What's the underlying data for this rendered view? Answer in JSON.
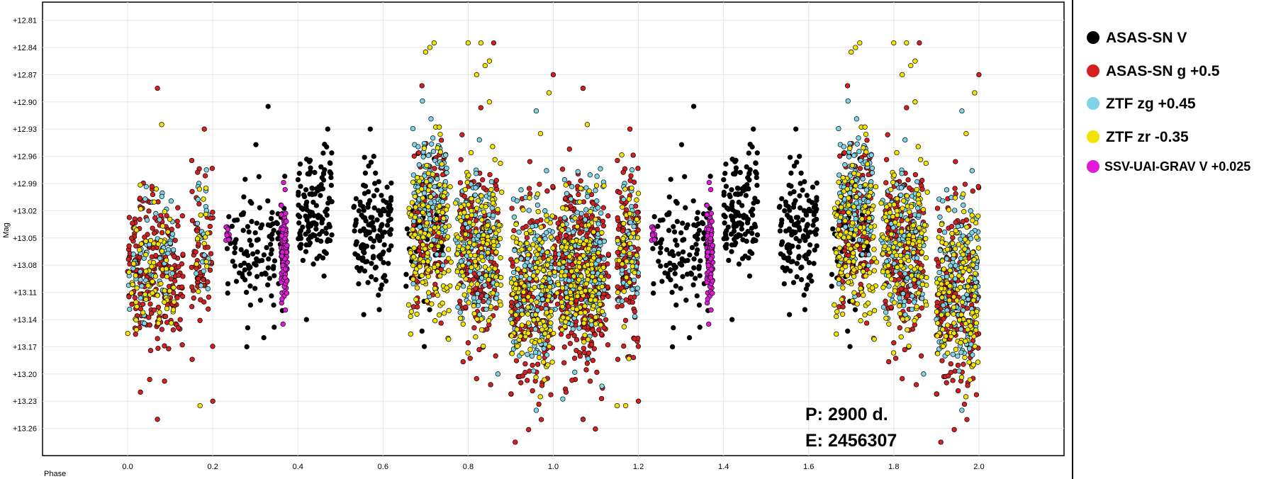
{
  "chart_data": {
    "type": "scatter",
    "ylabel": "Mag",
    "xlabel": "Phase",
    "x_ticks": [
      "0.0",
      "0.2",
      "0.4",
      "0.6",
      "0.8",
      "1.0",
      "1.2",
      "1.4",
      "1.6",
      "1.8",
      "2.0"
    ],
    "y_ticks": [
      "+12.81",
      "+12.84",
      "+12.87",
      "+12.90",
      "+12.93",
      "+12.96",
      "+12.99",
      "+13.02",
      "+13.05",
      "+13.08",
      "+13.11",
      "+13.14",
      "+13.17",
      "+13.20",
      "+13.23",
      "+13.26"
    ],
    "xlim": [
      -0.2,
      2.2
    ],
    "ylim": [
      12.79,
      13.29
    ],
    "y_inverted": true,
    "grid": true,
    "legend_position": "right",
    "annotations": [
      "P: 2900 d.",
      "E: 2456307"
    ],
    "series": [
      {
        "name": "ASAS-SN V",
        "color": "#000000",
        "clusters": [
          {
            "x": [
              0.23,
              0.27
            ],
            "y_mean": 13.075,
            "y_sd": 0.025,
            "count": 22
          },
          {
            "x": [
              0.27,
              0.37
            ],
            "y_mean": 13.06,
            "y_sd": 0.035,
            "count": 95
          },
          {
            "x": [
              0.4,
              0.48
            ],
            "y_mean": 13.02,
            "y_sd": 0.035,
            "count": 130
          },
          {
            "x": [
              0.53,
              0.62
            ],
            "y_mean": 13.04,
            "y_sd": 0.035,
            "count": 140
          },
          {
            "x": [
              0.65,
              0.74
            ],
            "y_mean": 13.06,
            "y_sd": 0.04,
            "count": 55
          }
        ],
        "points": [
          {
            "x": 0.33,
            "y": 12.905
          },
          {
            "x": 0.47,
            "y": 12.93
          },
          {
            "x": 0.42,
            "y": 13.14
          },
          {
            "x": 0.57,
            "y": 12.93
          },
          {
            "x": 0.32,
            "y": 13.16
          },
          {
            "x": 0.28,
            "y": 13.17
          }
        ]
      },
      {
        "name": "ASAS-SN g +0.5",
        "color": "#d42020",
        "clusters": [
          {
            "x": [
              0.0,
              0.13
            ],
            "y_mean": 13.09,
            "y_sd": 0.045,
            "count": 230
          },
          {
            "x": [
              0.15,
              0.2
            ],
            "y_mean": 13.07,
            "y_sd": 0.045,
            "count": 70
          },
          {
            "x": [
              0.67,
              0.75
            ],
            "y_mean": 13.03,
            "y_sd": 0.045,
            "count": 120
          },
          {
            "x": [
              0.78,
              0.87
            ],
            "y_mean": 13.07,
            "y_sd": 0.05,
            "count": 200
          },
          {
            "x": [
              0.9,
              1.0
            ],
            "y_mean": 13.12,
            "y_sd": 0.055,
            "count": 200
          },
          {
            "x": [
              1.02,
              1.12
            ],
            "y_mean": 13.1,
            "y_sd": 0.055,
            "count": 160
          },
          {
            "x": [
              1.15,
              1.2
            ],
            "y_mean": 13.07,
            "y_sd": 0.05,
            "count": 60
          }
        ],
        "points": [
          {
            "x": 0.07,
            "y": 12.885
          },
          {
            "x": 0.18,
            "y": 12.93
          },
          {
            "x": 0.86,
            "y": 12.835
          },
          {
            "x": 1.0,
            "y": 12.87
          },
          {
            "x": 1.07,
            "y": 12.885
          },
          {
            "x": 0.03,
            "y": 13.22
          },
          {
            "x": 0.07,
            "y": 13.25
          },
          {
            "x": 0.2,
            "y": 13.23
          },
          {
            "x": 1.07,
            "y": 13.25
          }
        ]
      },
      {
        "name": "ZTF zg +0.45",
        "color": "#7fd3e6",
        "clusters": [
          {
            "x": [
              0.0,
              0.11
            ],
            "y_mean": 13.08,
            "y_sd": 0.035,
            "count": 60
          },
          {
            "x": [
              0.16,
              0.19
            ],
            "y_mean": 13.05,
            "y_sd": 0.035,
            "count": 20
          },
          {
            "x": [
              0.67,
              0.75
            ],
            "y_mean": 13.01,
            "y_sd": 0.04,
            "count": 130
          },
          {
            "x": [
              0.77,
              0.87
            ],
            "y_mean": 13.06,
            "y_sd": 0.04,
            "count": 130
          },
          {
            "x": [
              0.9,
              1.0
            ],
            "y_mean": 13.1,
            "y_sd": 0.045,
            "count": 130
          },
          {
            "x": [
              1.02,
              1.12
            ],
            "y_mean": 13.09,
            "y_sd": 0.045,
            "count": 100
          },
          {
            "x": [
              1.15,
              1.2
            ],
            "y_mean": 13.07,
            "y_sd": 0.04,
            "count": 25
          }
        ],
        "points": [
          {
            "x": 0.96,
            "y": 12.91
          },
          {
            "x": 0.96,
            "y": 13.24
          },
          {
            "x": 0.87,
            "y": 13.2
          }
        ]
      },
      {
        "name": "ZTF zr -0.35",
        "color": "#f2e400",
        "clusters": [
          {
            "x": [
              0.0,
              0.11
            ],
            "y_mean": 13.09,
            "y_sd": 0.035,
            "count": 80
          },
          {
            "x": [
              0.16,
              0.19
            ],
            "y_mean": 13.06,
            "y_sd": 0.04,
            "count": 15
          },
          {
            "x": [
              0.66,
              0.76
            ],
            "y_mean": 13.05,
            "y_sd": 0.045,
            "count": 150
          },
          {
            "x": [
              0.77,
              0.88
            ],
            "y_mean": 13.06,
            "y_sd": 0.045,
            "count": 150
          },
          {
            "x": [
              0.9,
              1.0
            ],
            "y_mean": 13.11,
            "y_sd": 0.045,
            "count": 150
          },
          {
            "x": [
              1.02,
              1.12
            ],
            "y_mean": 13.09,
            "y_sd": 0.045,
            "count": 90
          },
          {
            "x": [
              1.15,
              1.2
            ],
            "y_mean": 13.06,
            "y_sd": 0.045,
            "count": 25
          }
        ],
        "points": [
          {
            "x": 0.7,
            "y": 12.845
          },
          {
            "x": 0.71,
            "y": 12.84
          },
          {
            "x": 0.72,
            "y": 12.835
          },
          {
            "x": 0.8,
            "y": 12.835
          },
          {
            "x": 0.83,
            "y": 12.835
          },
          {
            "x": 0.84,
            "y": 12.86
          },
          {
            "x": 0.85,
            "y": 12.855
          },
          {
            "x": 0.85,
            "y": 12.9
          },
          {
            "x": 0.82,
            "y": 12.87
          },
          {
            "x": 0.97,
            "y": 12.935
          },
          {
            "x": 0.99,
            "y": 12.89
          },
          {
            "x": 0.08,
            "y": 12.925
          },
          {
            "x": 0.17,
            "y": 13.235
          },
          {
            "x": 1.15,
            "y": 13.235
          }
        ]
      },
      {
        "name": "SSV-UAI-GRAV V +0.025",
        "color": "#e01ad8",
        "clusters": [
          {
            "x": [
              0.23,
              0.24
            ],
            "y_mean": 13.045,
            "y_sd": 0.006,
            "count": 12
          },
          {
            "x": [
              0.36,
              0.375
            ],
            "y_mean": 13.07,
            "y_sd": 0.025,
            "count": 110
          }
        ],
        "points": [
          {
            "x": 0.365,
            "y": 13.145
          }
        ]
      }
    ]
  }
}
